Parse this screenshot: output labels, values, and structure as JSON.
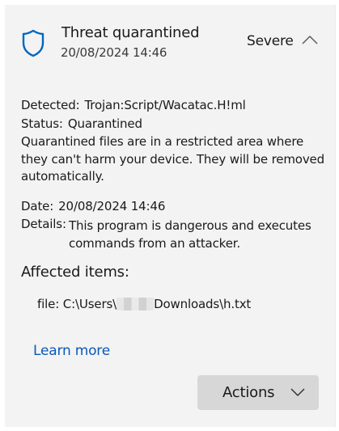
{
  "header": {
    "title": "Threat quarantined",
    "timestamp": "20/08/2024 14:46",
    "severity": "Severe",
    "shield_icon": "shield-icon",
    "collapse_icon": "chevron-up-icon",
    "accent_color": "#0067c0"
  },
  "detected": {
    "label": "Detected:",
    "value": "Trojan:Script/Wacatac.H!ml"
  },
  "status": {
    "label": "Status:",
    "value": "Quarantined"
  },
  "status_description": "Quarantined files are in a restricted area where they can't harm your device. They will be removed automatically.",
  "date": {
    "label": "Date:",
    "value": "20/08/2024 14:46"
  },
  "details": {
    "label": "Details:",
    "value": "This program is dangerous and executes commands from an attacker."
  },
  "affected": {
    "heading": "Affected items:",
    "file_prefix": "file: C:\\Users\\",
    "file_suffix": "Downloads\\h.txt"
  },
  "learn_more": "Learn more",
  "actions": {
    "label": "Actions",
    "icon": "chevron-down-icon"
  }
}
